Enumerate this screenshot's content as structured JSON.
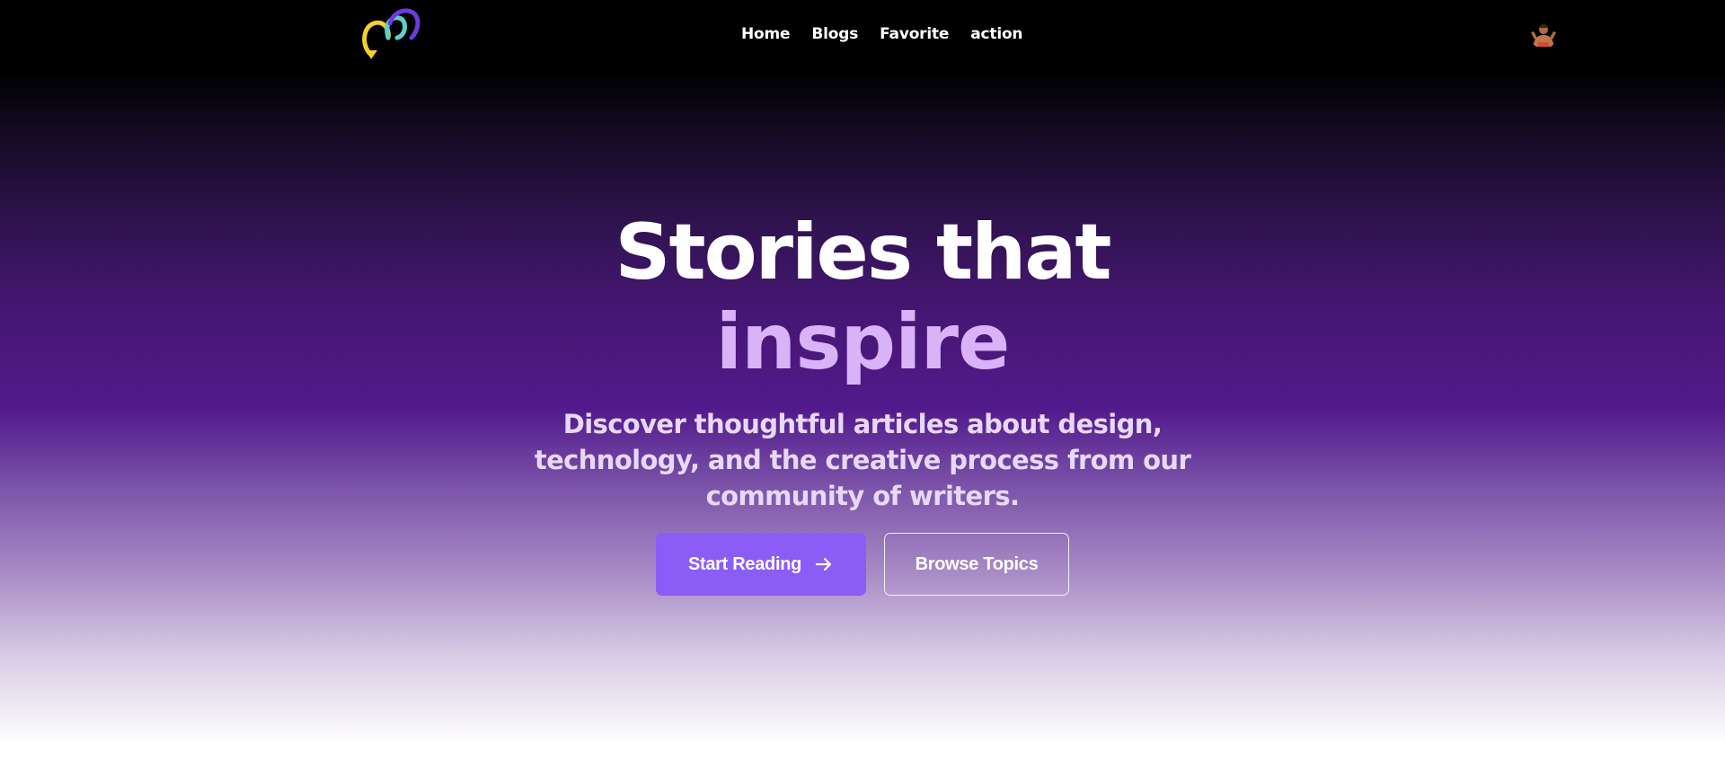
{
  "header": {
    "logo_icon": "colorful-loop-logo",
    "nav": [
      {
        "label": "Home"
      },
      {
        "label": "Blogs"
      },
      {
        "label": "Favorite"
      },
      {
        "label": "action"
      }
    ],
    "avatar_icon": "user-avatar"
  },
  "hero": {
    "title": "Stories that",
    "title_accent": "inspire",
    "subtitle": "Discover thoughtful articles about design, technology, and the creative process from our community of writers.",
    "primary_button": {
      "label": "Start Reading",
      "icon": "arrow-right-icon"
    },
    "secondary_button": {
      "label": "Browse Topics"
    }
  },
  "colors": {
    "accent": "#8b5cf6",
    "accent_text": "#d9b2f8",
    "logo_yellow": "#f5d02a",
    "logo_teal": "#5fd0c8",
    "logo_purple": "#6a3be0"
  }
}
